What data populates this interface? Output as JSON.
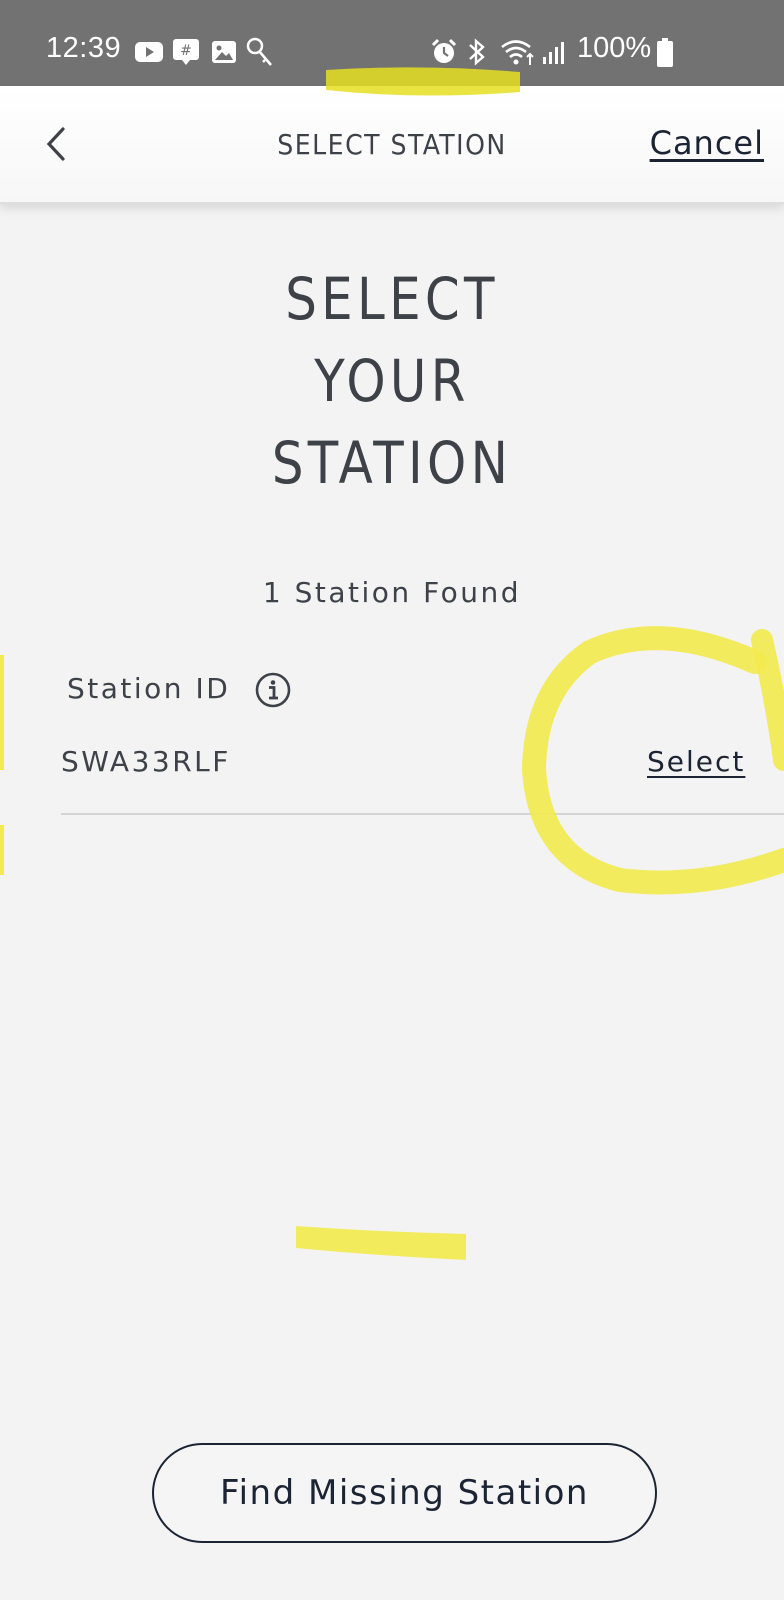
{
  "status_bar": {
    "time": "12:39",
    "battery": "100%",
    "icons": [
      "youtube-icon",
      "groupme-icon",
      "gallery-icon",
      "key-icon",
      "alarm-icon",
      "bluetooth-icon",
      "wifi-icon",
      "signal-icon",
      "battery-icon"
    ]
  },
  "header": {
    "back_icon": "chevron-left-icon",
    "title": "SELECT STATION",
    "cancel_label": "Cancel"
  },
  "main": {
    "heading_lines": [
      "SELECT",
      "YOUR",
      "STATION"
    ],
    "found_text": "1 Station Found",
    "station_label": "Station ID",
    "info_icon": "info-icon",
    "stations": [
      {
        "id": "SWA33RLF",
        "action_label": "Select"
      }
    ]
  },
  "footer": {
    "find_missing_label": "Find Missing Station"
  },
  "colors": {
    "status_bar_bg": "#727272",
    "page_bg": "#f3f3f3",
    "text": "#3e4148",
    "link": "#1c2433",
    "annotation_yellow": "#f2ea4e"
  }
}
